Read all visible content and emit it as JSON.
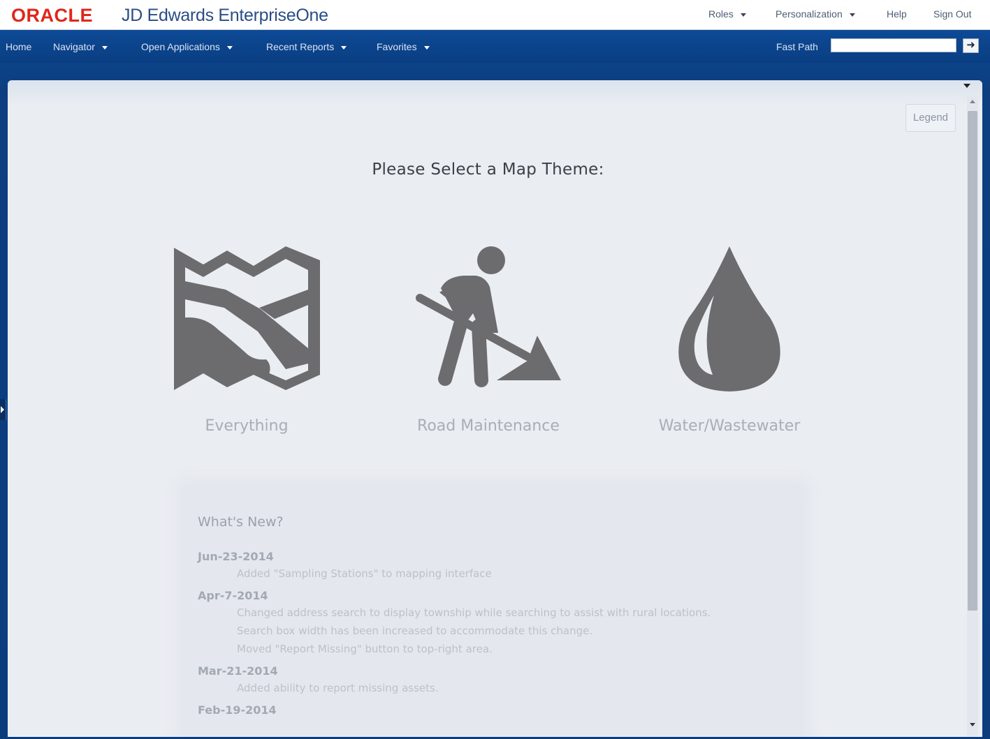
{
  "header": {
    "logo_brand": "ORACLE",
    "logo_product": "JD Edwards EnterpriseOne",
    "links": [
      {
        "label": "Roles",
        "dropdown": true
      },
      {
        "label": "Personalization",
        "dropdown": true
      },
      {
        "label": "Help",
        "dropdown": false
      },
      {
        "label": "Sign Out",
        "dropdown": false
      }
    ]
  },
  "nav": {
    "items": [
      {
        "label": "Home",
        "dropdown": false
      },
      {
        "label": "Navigator",
        "dropdown": true
      },
      {
        "label": "Open Applications",
        "dropdown": true
      },
      {
        "label": "Recent Reports",
        "dropdown": true
      },
      {
        "label": "Favorites",
        "dropdown": true
      }
    ],
    "fast_path_label": "Fast Path",
    "fast_path_value": "",
    "go_icon": "arrow-right-icon"
  },
  "panel": {
    "legend_label": "Legend",
    "title": "Please Select a Map Theme:",
    "themes": [
      {
        "label": "Everything",
        "icon": "map-icon"
      },
      {
        "label": "Road Maintenance",
        "icon": "road-worker-icon"
      },
      {
        "label": "Water/Wastewater",
        "icon": "water-drop-icon"
      }
    ]
  },
  "whats_new": {
    "title": "What's New?",
    "entries": [
      {
        "date": "Jun-23-2014",
        "lines": [
          "Added \"Sampling Stations\" to mapping interface"
        ]
      },
      {
        "date": "Apr-7-2014",
        "lines": [
          "Changed address search to display township while searching to assist with rural locations.",
          "Search box width has been increased to accommodate this change.",
          "Moved \"Report Missing\" button to top-right area."
        ]
      },
      {
        "date": "Mar-21-2014",
        "lines": [
          "Added ability to report missing assets."
        ]
      },
      {
        "date": "Feb-19-2014",
        "lines": []
      }
    ]
  },
  "colors": {
    "brand_red": "#e0261b",
    "nav_blue": "#0b3d7d",
    "panel_bg": "#eaedf2",
    "icon_gray": "#6c6c6e"
  }
}
